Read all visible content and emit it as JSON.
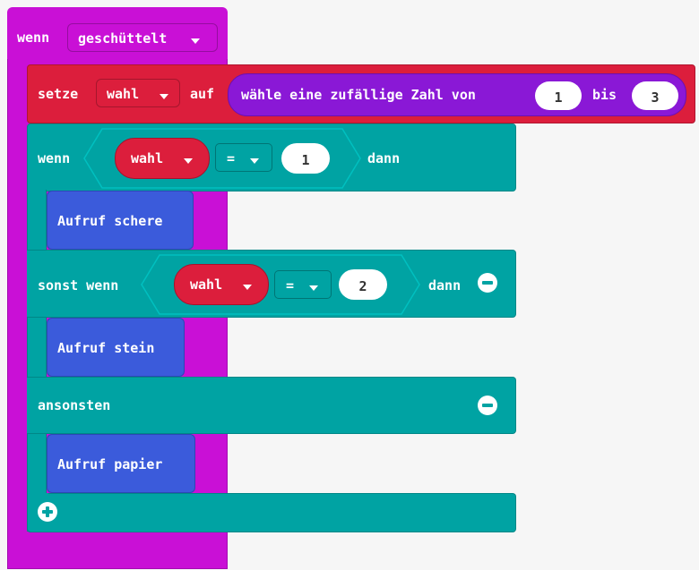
{
  "event_block": {
    "label": "wenn",
    "event_value": "geschüttelt"
  },
  "set_block": {
    "label": "setze",
    "variable": "wahl",
    "to_label": "auf",
    "random": {
      "label": "wähle eine zufällige Zahl von",
      "from": "1",
      "to_label": "bis",
      "to": "3"
    }
  },
  "if_block": {
    "if_label": "wenn",
    "condition1": {
      "variable": "wahl",
      "operator": "=",
      "value": "1"
    },
    "then_label": "dann",
    "call1": "Aufruf schere",
    "elseif_label": "sonst wenn",
    "condition2": {
      "variable": "wahl",
      "operator": "=",
      "value": "2"
    },
    "then_label2": "dann",
    "call2": "Aufruf stein",
    "else_label": "ansonsten",
    "call3": "Aufruf papier"
  },
  "icons": {
    "remove_elseif": "minus-circle-icon",
    "remove_else": "minus-circle-icon",
    "add_branch": "plus-circle-icon"
  },
  "colors": {
    "event": "#c910d6",
    "variables": "#dc1e3c",
    "math": "#8a18d6",
    "logic": "#00a3a3",
    "functions": "#3b5bdb"
  }
}
